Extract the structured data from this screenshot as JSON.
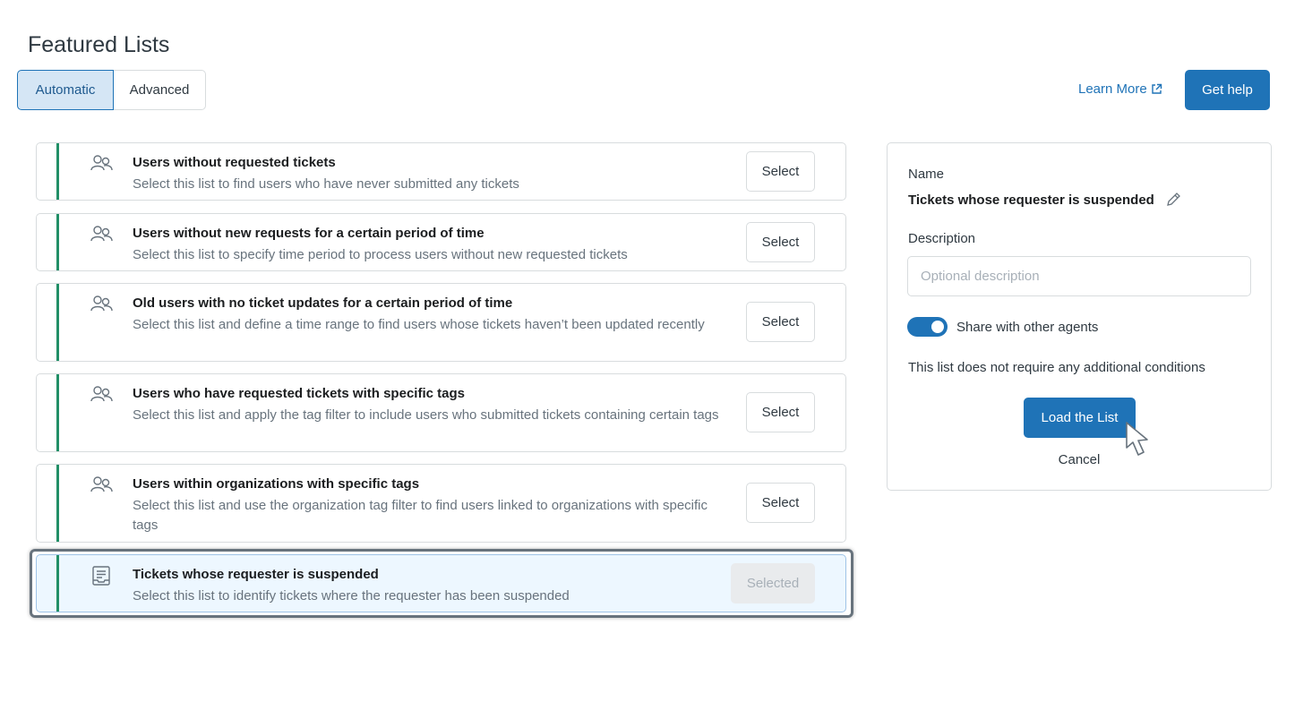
{
  "page": {
    "title": "Featured Lists"
  },
  "mode_tabs": {
    "automatic": "Automatic",
    "advanced": "Advanced",
    "selected": "Automatic"
  },
  "header": {
    "learn_more": "Learn More",
    "get_help": "Get help"
  },
  "lists": [
    {
      "title": "Users without requested tickets",
      "description": "Select this list to find users who have never submitted any tickets",
      "button": "Select",
      "icon": "users-icon"
    },
    {
      "title": "Users without new requests for a certain period of time",
      "description": "Select this list to specify time period to process users without new requested tickets",
      "button": "Select",
      "icon": "users-icon"
    },
    {
      "title": "Old users with no ticket updates for a certain period of time",
      "description": "Select this list and define a time range to find users whose tickets haven’t been updated recently",
      "button": "Select",
      "icon": "users-icon"
    },
    {
      "title": "Users who have requested tickets with specific tags",
      "description": "Select this list and apply the tag filter to include users who submitted tickets containing certain tags",
      "button": "Select",
      "icon": "users-icon"
    },
    {
      "title": "Users within organizations with specific tags",
      "description": "Select this list and use the organization tag filter to find users linked to organizations with specific tags",
      "button": "Select",
      "icon": "users-icon"
    },
    {
      "title": "Tickets whose requester is suspended",
      "description": "Select this list to identify tickets where the requester has been suspended",
      "button": "Selected",
      "icon": "ticket-inbox-icon"
    }
  ],
  "panel": {
    "name_label": "Name",
    "name_value": "Tickets whose requester is suspended",
    "description_label": "Description",
    "description_value": "",
    "description_placeholder": "Optional description",
    "share_label": "Share with other agents",
    "share_enabled": true,
    "conditions_text": "This list does not require any additional conditions",
    "load_button": "Load the List",
    "cancel": "Cancel"
  },
  "colors": {
    "accent": "#1f73b7",
    "bar": "#228f67",
    "selected_bg": "#edf7ff"
  }
}
